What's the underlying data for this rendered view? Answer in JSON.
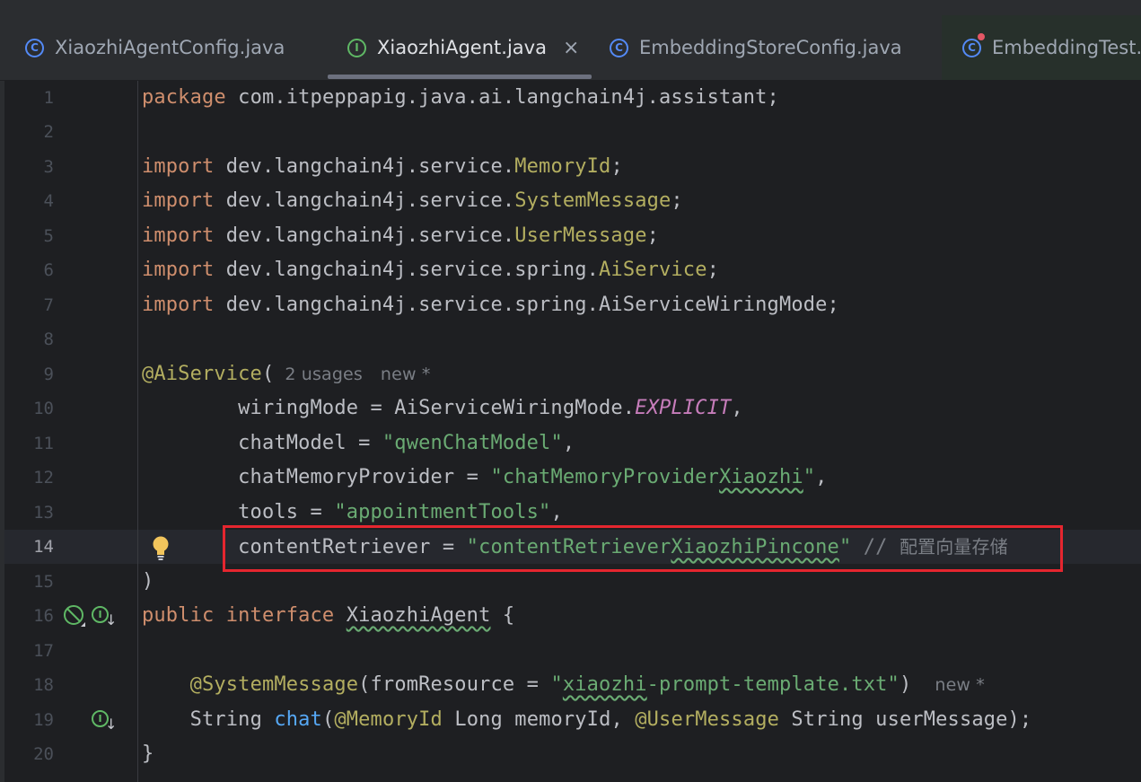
{
  "tabs": [
    {
      "label": "XiaozhiAgentConfig.java",
      "icon": "class-icon",
      "active": false
    },
    {
      "label": "XiaozhiAgent.java",
      "icon": "interface-icon",
      "active": true,
      "close": "×"
    },
    {
      "label": "EmbeddingStoreConfig.java",
      "icon": "class-icon",
      "active": false
    },
    {
      "label": "EmbeddingTest.j",
      "icon": "test-class-icon",
      "active": false
    }
  ],
  "current_line": 14,
  "line_numbers": [
    "1",
    "2",
    "3",
    "4",
    "5",
    "6",
    "7",
    "8",
    "9",
    "10",
    "11",
    "12",
    "13",
    "14",
    "15",
    "16",
    "17",
    "18",
    "19",
    "20"
  ],
  "code": {
    "l1": {
      "kw": "package",
      "rest": " com.itpeppapig.java.ai.langchain4j.assistant;"
    },
    "l3": {
      "kw": "import",
      "pkg": " dev.langchain4j.service.",
      "cls": "MemoryId",
      "end": ";"
    },
    "l4": {
      "kw": "import",
      "pkg": " dev.langchain4j.service.",
      "cls": "SystemMessage",
      "end": ";"
    },
    "l5": {
      "kw": "import",
      "pkg": " dev.langchain4j.service.",
      "cls": "UserMessage",
      "end": ";"
    },
    "l6": {
      "kw": "import",
      "pkg": " dev.langchain4j.service.spring.",
      "cls": "AiService",
      "end": ";"
    },
    "l7": {
      "kw": "import",
      "rest": " dev.langchain4j.service.spring.AiServiceWiringMode;"
    },
    "l9": {
      "ann": "@AiService",
      "paren": "(",
      "usages": "2 usages",
      "new": "new *"
    },
    "l10": {
      "lhs": "        wiringMode = AiServiceWiringMode.",
      "const": "EXPLICIT",
      "end": ","
    },
    "l11": {
      "lhs": "        chatModel = ",
      "str": "\"qwenChatModel\"",
      "end": ","
    },
    "l12": {
      "lhs": "        chatMemoryProvider = ",
      "str_a": "\"chatMemoryProvider",
      "str_b": "Xiaozhi",
      "str_c": "\"",
      "end": ","
    },
    "l13": {
      "lhs": "        tools = ",
      "str": "\"appointmentTools\"",
      "end": ","
    },
    "l14": {
      "lhs": "        contentRetriever = ",
      "str_a": "\"contentRetriever",
      "str_b": "XiaozhiPincone",
      "str_c": "\"",
      "comment": " // ",
      "comment_text": "配置向量存储"
    },
    "l15": {
      "text": ")"
    },
    "l16": {
      "kw1": "public",
      "kw2": " interface ",
      "name": "XiaozhiAgent",
      "end": " {"
    },
    "l18": {
      "indent": "    ",
      "ann": "@SystemMessage",
      "a": "(fromResource = ",
      "str_q": "\"",
      "str_b": "xiaozhi",
      "str_c": "-prompt-template.txt\"",
      "end": ")",
      "new": "new *"
    },
    "l19": {
      "indent": "    ",
      "type": "String ",
      "fn": "chat",
      "p1": "(",
      "ann1": "@MemoryId",
      "m1": " Long memoryId, ",
      "ann2": "@UserMessage",
      "m2": " String userMessage);"
    },
    "l20": {
      "text": "}"
    }
  }
}
